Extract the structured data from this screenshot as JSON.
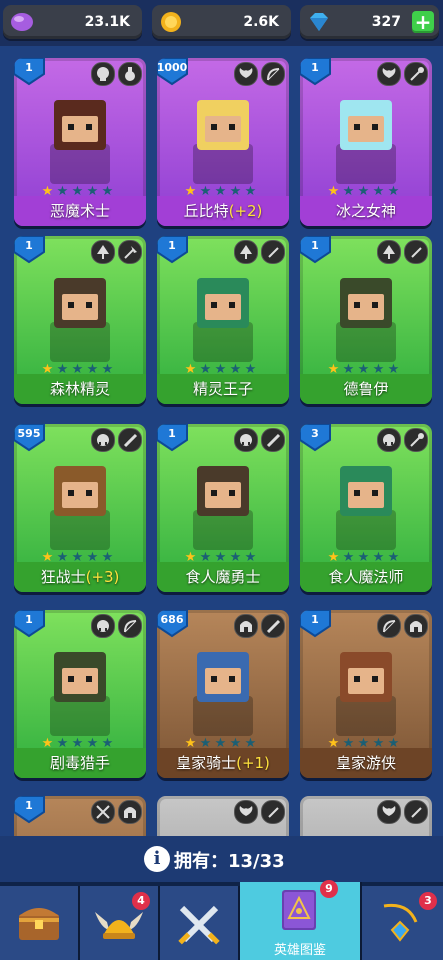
{
  "resources": [
    {
      "icon": "purple-gem-icon",
      "value": "23.1K"
    },
    {
      "icon": "gold-coin-icon",
      "value": "2.6K"
    },
    {
      "icon": "blue-diamond-icon",
      "value": "327",
      "plus": "+"
    }
  ],
  "heroes": [
    {
      "name": "恶魔术士",
      "bonus": "",
      "level": "1",
      "stars": 1,
      "bg": "purple",
      "class1": "skull-class-icon",
      "class2": "flask-weapon-icon"
    },
    {
      "name": "丘比特",
      "bonus": "(+2)",
      "level": "1000",
      "stars": 1,
      "bg": "purple",
      "class1": "wings-class-icon",
      "class2": "bow-weapon-icon"
    },
    {
      "name": "冰之女神",
      "bonus": "",
      "level": "1",
      "stars": 1,
      "bg": "purple",
      "class1": "wings-class-icon",
      "class2": "staff-weapon-icon"
    },
    {
      "name": "森林精灵",
      "bonus": "",
      "level": "1",
      "stars": 1,
      "bg": "green",
      "class1": "tree-class-icon",
      "class2": "axe-weapon-icon"
    },
    {
      "name": "精灵王子",
      "bonus": "",
      "level": "1",
      "stars": 1,
      "bg": "green",
      "class1": "tree-class-icon",
      "class2": "dagger-weapon-icon"
    },
    {
      "name": "德鲁伊",
      "bonus": "",
      "level": "1",
      "stars": 1,
      "bg": "green",
      "class1": "tree-class-icon",
      "class2": "dagger-weapon-icon"
    },
    {
      "name": "狂战士",
      "bonus": "(+3)",
      "level": "595",
      "stars": 1,
      "bg": "green",
      "class1": "orc-class-icon",
      "class2": "sword-weapon-icon"
    },
    {
      "name": "食人魔勇士",
      "bonus": "",
      "level": "1",
      "stars": 1,
      "bg": "green",
      "class1": "orc-class-icon",
      "class2": "sword-weapon-icon"
    },
    {
      "name": "食人魔法师",
      "bonus": "",
      "level": "3",
      "stars": 1,
      "bg": "green",
      "class1": "orc-class-icon",
      "class2": "staff-weapon-icon"
    },
    {
      "name": "剧毒猎手",
      "bonus": "",
      "level": "1",
      "stars": 1,
      "bg": "green",
      "class1": "orc-class-icon",
      "class2": "bow-weapon-icon"
    },
    {
      "name": "皇家骑士",
      "bonus": "(+1)",
      "level": "686",
      "stars": 1,
      "bg": "brown",
      "class1": "helmet-class-icon",
      "class2": "sword-weapon-icon"
    },
    {
      "name": "皇家游侠",
      "bonus": "",
      "level": "1",
      "stars": 1,
      "bg": "brown",
      "class1": "bow-weapon-icon",
      "class2": "helmet-class-icon"
    },
    {
      "name": "",
      "bonus": "",
      "level": "1",
      "stars": 0,
      "bg": "brown",
      "class1": "crossed-swords-icon",
      "class2": "helmet-class-icon"
    },
    {
      "name": "",
      "bonus": "",
      "level": "",
      "stars": 0,
      "bg": "gray",
      "class1": "wings-class-icon",
      "class2": "dagger-weapon-icon"
    },
    {
      "name": "",
      "bonus": "",
      "level": "",
      "stars": 0,
      "bg": "gray",
      "class1": "wings-class-icon",
      "class2": "dagger-weapon-icon"
    }
  ],
  "collection": {
    "label": "拥有：",
    "count": "13/33"
  },
  "nav": [
    {
      "icon": "treasure-chest-icon",
      "label": "",
      "badge": ""
    },
    {
      "icon": "viking-helmet-icon",
      "label": "",
      "badge": "4"
    },
    {
      "icon": "crossed-swords-icon",
      "label": "",
      "badge": ""
    },
    {
      "icon": "hero-book-icon",
      "label": "英雄图鉴",
      "badge": "9",
      "active": true
    },
    {
      "icon": "amulet-icon",
      "label": "",
      "badge": "3"
    }
  ]
}
